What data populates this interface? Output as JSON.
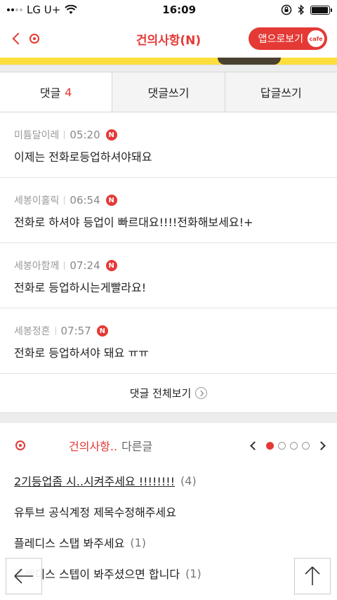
{
  "status_bar": {
    "carrier": "LG U+",
    "time": "16:09",
    "battery_level": 0.95
  },
  "header": {
    "title": "건의사항(N)",
    "app_button_label": "앱으로보기",
    "cafe_badge": "cafe"
  },
  "tabs": [
    {
      "label": "댓글",
      "count": "4"
    },
    {
      "label": "댓글쓰기"
    },
    {
      "label": "답글쓰기"
    }
  ],
  "comments": [
    {
      "author": "미튬달이레",
      "time": "05:20",
      "badge": "N",
      "text": "이제는 전화로등업하셔야돼요"
    },
    {
      "author": "세봉이홀릭",
      "time": "06:54",
      "badge": "N",
      "text": "전화로 하셔야 등업이 빠르대요!!!!전화해보세요!+"
    },
    {
      "author": "세봉아함께",
      "time": "07:24",
      "badge": "N",
      "text": "전화로 등업하시는게빨라요!"
    },
    {
      "author": "세봉정흔",
      "time": "07:57",
      "badge": "N",
      "text": "전화로 등업하셔야 돼요 ㅠㅠ"
    }
  ],
  "view_all_label": "댓글 전체보기",
  "other_posts": {
    "title": "건의사항..",
    "subtitle": "다른글",
    "current_page": 1,
    "page_count": 4,
    "items": [
      {
        "title": "2기등업좀 시..시켜주세요 !!!!!!!!",
        "count": "(4)"
      },
      {
        "title": "유투브 공식계정 제목수정해주세요",
        "count": ""
      },
      {
        "title": "플레디스 스탭 봐주세요",
        "count": "(1)"
      },
      {
        "title": "플레디스 스텝이 봐주셨으면 합니다",
        "count": "(1)"
      }
    ]
  },
  "colors": {
    "accent": "#e53935",
    "banner": "#fcdf3c"
  },
  "icons": {
    "back": "arrow-left-icon",
    "top": "arrow-up-icon"
  }
}
